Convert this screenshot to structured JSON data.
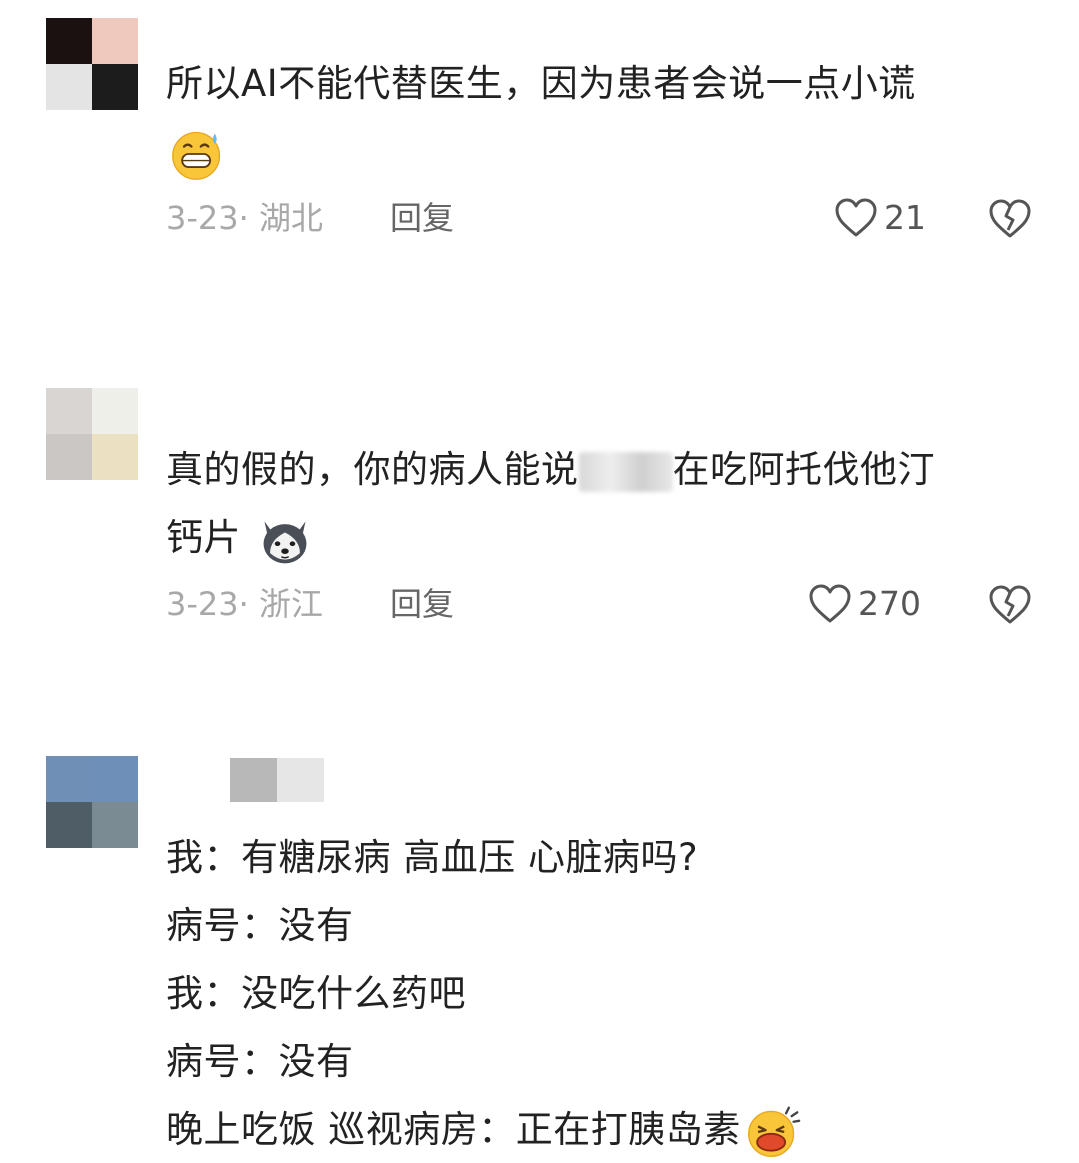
{
  "comments": [
    {
      "avatar_colors": [
        "#1a1111",
        "#efc9bd",
        "#e4e4e4",
        "#1c1c1c"
      ],
      "text_lines": [
        "所以AI不能代替医生，因为患者会说一点小谎"
      ],
      "emoji": "sweat-grin-emoji",
      "date": "3-23· 湖北",
      "reply": "回复",
      "likes": "21"
    },
    {
      "avatar_colors": [
        "#d9d5d3",
        "#efefea",
        "#cbc7c5",
        "#ece0c2"
      ],
      "text_lines_prefix": "真的假的，你的病人能说",
      "text_lines_suffix": "在吃阿托伐他汀",
      "text_line2": "钙片",
      "emoji": "husky-emoji",
      "date": "3-23· 浙江",
      "reply": "回复",
      "likes": "270"
    },
    {
      "avatar_colors": [
        "#6f8fb6",
        "#6e8fb7",
        "#4e5d66",
        "#7b8b93"
      ],
      "username_colors": [
        "#b8b8b8",
        "#e6e6e6"
      ],
      "text_lines": [
        "我：有糖尿病 高血压 心脏病吗?",
        "病号：没有",
        "我：没吃什么药吧",
        "病号：没有",
        "晚上吃饭 巡视病房：正在打胰岛素"
      ],
      "emoji": "laughing-cry-emoji"
    }
  ]
}
